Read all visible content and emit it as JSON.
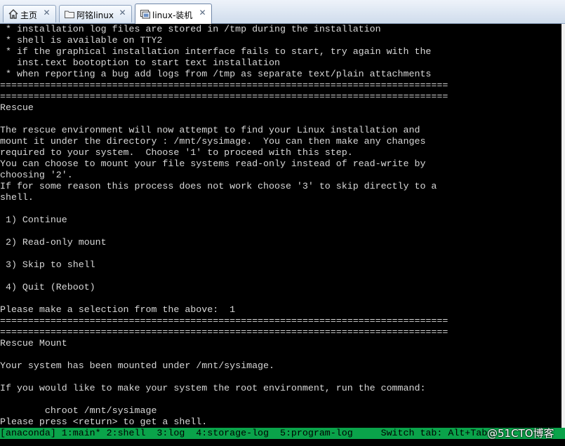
{
  "tabs": [
    {
      "label": "主页",
      "icon": "home-icon",
      "close": "✕",
      "active": false
    },
    {
      "label": "阿铭linux",
      "icon": "folder-icon",
      "close": "✕",
      "active": false
    },
    {
      "label": "linux-装机",
      "icon": "vm-icon",
      "close": "✕",
      "active": true
    }
  ],
  "console": {
    "lines": [
      " * installation log files are stored in /tmp during the installation",
      " * shell is available on TTY2",
      " * if the graphical installation interface fails to start, try again with the",
      "   inst.text bootoption to start text installation",
      " * when reporting a bug add logs from /tmp as separate text/plain attachments",
      "================================================================================",
      "================================================================================",
      "Rescue",
      "",
      "The rescue environment will now attempt to find your Linux installation and",
      "mount it under the directory : /mnt/sysimage.  You can then make any changes",
      "required to your system.  Choose '1' to proceed with this step.",
      "You can choose to mount your file systems read-only instead of read-write by",
      "choosing '2'.",
      "If for some reason this process does not work choose '3' to skip directly to a",
      "shell.",
      "",
      " 1) Continue",
      "",
      " 2) Read-only mount",
      "",
      " 3) Skip to shell",
      "",
      " 4) Quit (Reboot)",
      "",
      "Please make a selection from the above:  1",
      "================================================================================",
      "================================================================================",
      "Rescue Mount",
      "",
      "Your system has been mounted under /mnt/sysimage.",
      "",
      "If you would like to make your system the root environment, run the command:",
      "",
      "        chroot /mnt/sysimage",
      "Please press <return> to get a shell."
    ]
  },
  "statusbar": {
    "text": "[anaconda] 1:main* 2:shell  3:log  4:storage-log  5:program-log     Switch tab: Alt+Tab"
  },
  "watermark": "@51CTO博客",
  "colors": {
    "terminal_bg": "#000000",
    "terminal_fg": "#d8d8d8",
    "statusbar_bg": "#0aa34a",
    "tabbar_bg": "#dce7f3"
  }
}
